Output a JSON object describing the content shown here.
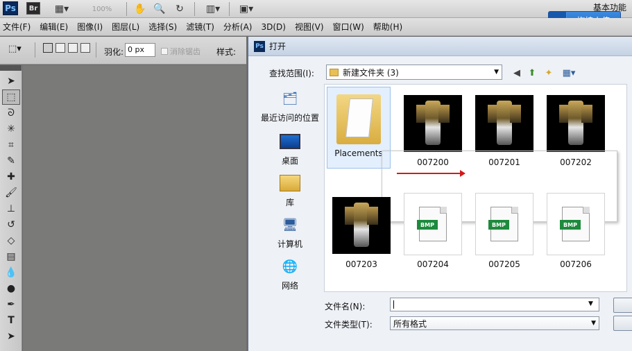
{
  "app": {
    "logo": "Ps",
    "bridge_logo": "Br",
    "zoom": "100%",
    "workspace": "基本功能"
  },
  "upload": {
    "label": "拖拽上传",
    "icon": "cloud-icon"
  },
  "menu": [
    "文件(F)",
    "编辑(E)",
    "图像(I)",
    "图层(L)",
    "选择(S)",
    "滤镜(T)",
    "分析(A)",
    "3D(D)",
    "视图(V)",
    "窗口(W)",
    "帮助(H)"
  ],
  "options": {
    "feather_label": "羽化:",
    "feather_value": "0 px",
    "antialias_label": "消除锯齿",
    "style_label": "样式:"
  },
  "dialog": {
    "title": "打开",
    "look_in_label": "查找范围(I):",
    "look_in_value": "新建文件夹 (3)",
    "places": [
      {
        "label": "最近访问的位置",
        "icon": "recent-places-icon"
      },
      {
        "label": "桌面",
        "icon": "desktop-icon"
      },
      {
        "label": "库",
        "icon": "library-icon"
      },
      {
        "label": "计算机",
        "icon": "computer-icon"
      },
      {
        "label": "网络",
        "icon": "network-icon"
      }
    ],
    "files": [
      {
        "name": "Placements",
        "kind": "folder"
      },
      {
        "name": "007200",
        "kind": "image"
      },
      {
        "name": "007201",
        "kind": "image"
      },
      {
        "name": "007202",
        "kind": "image"
      },
      {
        "name": "007203",
        "kind": "image"
      },
      {
        "name": "007204",
        "kind": "bmp"
      },
      {
        "name": "007205",
        "kind": "bmp"
      },
      {
        "name": "007206",
        "kind": "bmp"
      }
    ],
    "bmp_tag": "BMP",
    "filename_label": "文件名(N):",
    "filename_value": "",
    "filetype_label": "文件类型(T):",
    "filetype_value": "所有格式"
  },
  "colors": {
    "accent": "#1e67c2",
    "arrow": "#d21a1a",
    "dialog_bg": "#eef1f6"
  }
}
